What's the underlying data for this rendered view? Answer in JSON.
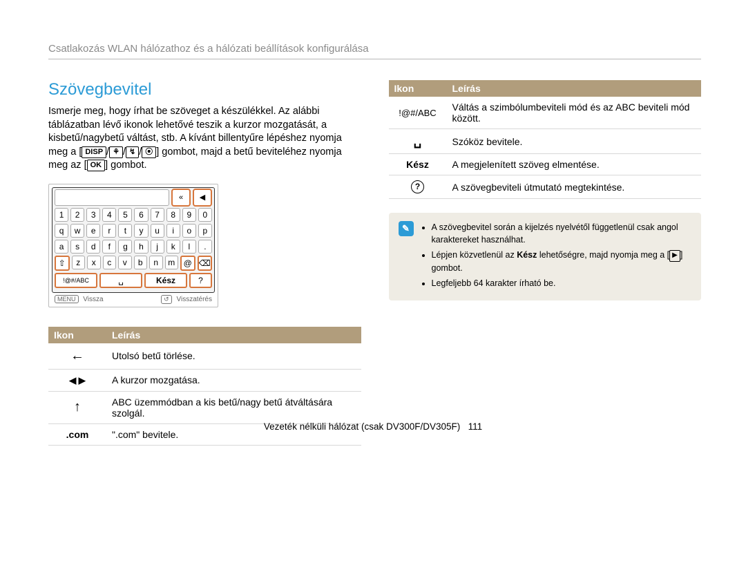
{
  "breadcrumb": "Csatlakozás WLAN hálózathoz és a hálózati beállítások konfigurálása",
  "title": "Szövegbevitel",
  "intro_parts": {
    "p1": "Ismerje meg, hogy írhat be szöveget a készülékkel. Az alábbi táblázatban lévő ikonok lehetővé teszik a kurzor mozgatását, a kisbetű/nagybetű váltást, stb. A kívánt billentyűre lépéshez nyomja meg a [",
    "disp": "DISP",
    "sep": "/",
    "ic1": "⚘",
    "ic2": "↯",
    "ic3": "⦿",
    "p2": "] gombot, majd a betű beviteléhez nyomja meg az [",
    "ok": "OK",
    "p3": "] gombot."
  },
  "keyboard": {
    "top_icons": [
      "«",
      "◀"
    ],
    "rows": [
      [
        "1",
        "2",
        "3",
        "4",
        "5",
        "6",
        "7",
        "8",
        "9",
        "0"
      ],
      [
        "q",
        "w",
        "e",
        "r",
        "t",
        "y",
        "u",
        "i",
        "o",
        "p"
      ],
      [
        "a",
        "s",
        "d",
        "f",
        "g",
        "h",
        "j",
        "k",
        "l",
        "."
      ]
    ],
    "row4": {
      "shift": "⇧",
      "keys": [
        "z",
        "x",
        "c",
        "v",
        "b",
        "n",
        "m"
      ],
      "at": "@",
      "bs": "⌫"
    },
    "row5": {
      "mode": "!@#/ABC",
      "space": "␣",
      "done": "Kész",
      "help": "?"
    },
    "footer": {
      "menu": "MENU",
      "back": "Vissza",
      "reset_icon": "↺",
      "reset": "Visszatérés"
    }
  },
  "tbl": {
    "h_ikon": "Ikon",
    "h_leiras": "Leírás",
    "r_back": "Utolsó betű törlése.",
    "r_cursor": "A kurzor mozgatása.",
    "r_shift": "ABC üzemmódban a kis betű/nagy betű átváltására szolgál.",
    "r_com_icon": ".com",
    "r_com": "\".com\" bevitele.",
    "r_mode_icon": "!@#/ABC",
    "r_mode": "Váltás a szimbólumbeviteli mód és az ABC beviteli mód között.",
    "r_space": "Szóköz bevitele.",
    "r_done_icon": "Kész",
    "r_done": "A megjelenített szöveg elmentése.",
    "r_help": "A szövegbeviteli útmutató megtekintése."
  },
  "note": {
    "li1_a": "A szövegbevitel során a kijelzés nyelvétől függetlenül csak angol karaktereket használhat.",
    "li2_a": "Lépjen közvetlenül az ",
    "li2_b": "Kész",
    "li2_c": " lehetőségre, majd nyomja meg a [",
    "li2_icon": "▶",
    "li2_d": "] gombot.",
    "li3": "Legfeljebb 64 karakter írható be."
  },
  "footer": {
    "label": "Vezeték nélküli hálózat  (csak DV300F/DV305F)",
    "page": "111"
  }
}
